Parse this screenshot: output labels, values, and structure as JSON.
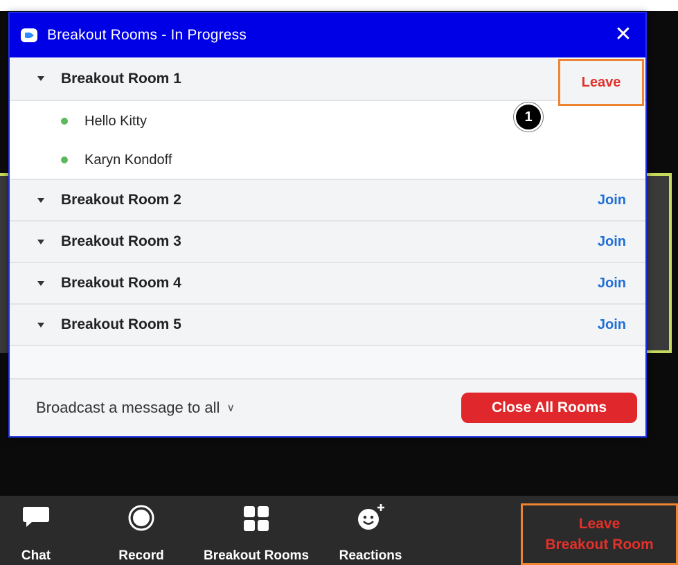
{
  "dialog": {
    "title": "Breakout Rooms - In Progress",
    "close_icon": "close-icon",
    "rooms": [
      {
        "name": "Breakout Room 1",
        "action": "Leave",
        "participants": [
          "Hello Kitty",
          "Karyn Kondoff"
        ]
      },
      {
        "name": "Breakout Room 2",
        "action": "Join"
      },
      {
        "name": "Breakout Room 3",
        "action": "Join"
      },
      {
        "name": "Breakout Room 4",
        "action": "Join"
      },
      {
        "name": "Breakout Room 5",
        "action": "Join"
      }
    ],
    "broadcast_label": "Broadcast a message to all",
    "close_all_label": "Close All Rooms"
  },
  "callout": {
    "number": "1"
  },
  "toolbar": {
    "items": [
      {
        "label": "Chat",
        "icon": "chat-icon"
      },
      {
        "label": "Record",
        "icon": "record-icon"
      },
      {
        "label": "Breakout Rooms",
        "icon": "breakout-rooms-icon"
      },
      {
        "label": "Reactions",
        "icon": "reactions-icon"
      }
    ],
    "leave_line1": "Leave",
    "leave_line2": "Breakout Room"
  },
  "colors": {
    "titlebar": "#0000e6",
    "join": "#1f6fd6",
    "leave": "#e2312a",
    "close_all": "#e0272b",
    "highlight": "#ef8430",
    "toolbar": "#2b2b2b"
  }
}
